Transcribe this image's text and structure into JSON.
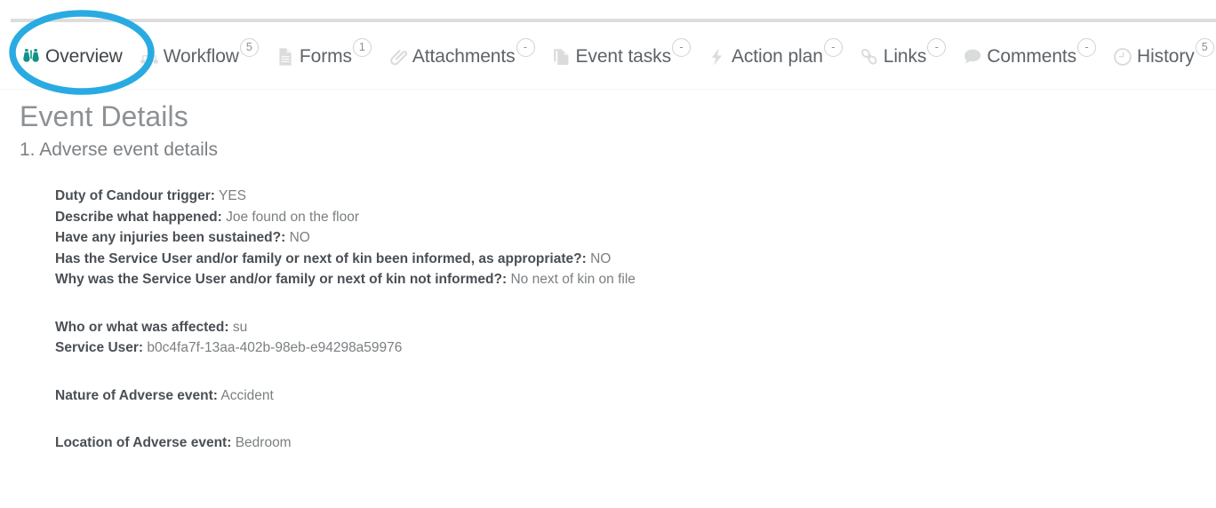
{
  "tabs": [
    {
      "label": "Overview",
      "icon": "binoculars-icon",
      "badge": "",
      "active": true
    },
    {
      "label": "Workflow",
      "icon": "sitemap-icon",
      "badge": "5",
      "active": false
    },
    {
      "label": "Forms",
      "icon": "document-icon",
      "badge": "1",
      "active": false
    },
    {
      "label": "Attachments",
      "icon": "paperclip-icon",
      "badge": "-",
      "active": false
    },
    {
      "label": "Event tasks",
      "icon": "copy-pages-icon",
      "badge": "-",
      "active": false
    },
    {
      "label": "Action plan",
      "icon": "lightning-icon",
      "badge": "-",
      "active": false
    },
    {
      "label": "Links",
      "icon": "chain-link-icon",
      "badge": "-",
      "active": false
    },
    {
      "label": "Comments",
      "icon": "speech-bubble-icon",
      "badge": "-",
      "active": false
    },
    {
      "label": "History",
      "icon": "clock-icon",
      "badge": "5",
      "active": false
    }
  ],
  "content": {
    "page_title": "Event Details",
    "section_title": "1. Adverse event details",
    "groups": [
      {
        "rows": [
          {
            "label": "Duty of Candour trigger:",
            "value": "YES"
          },
          {
            "label": "Describe what happened:",
            "value": "Joe found on the floor"
          },
          {
            "label": "Have any injuries been sustained?:",
            "value": "NO"
          },
          {
            "label": "Has the Service User and/or family or next of kin been informed, as appropriate?:",
            "value": "NO"
          },
          {
            "label": "Why was the Service User and/or family or next of kin not informed?:",
            "value": "No next of kin on file"
          }
        ]
      },
      {
        "rows": [
          {
            "label": "Who or what was affected:",
            "value": "su"
          },
          {
            "label": "Service User:",
            "value": "b0c4fa7f-13aa-402b-98eb-e94298a59976"
          }
        ]
      },
      {
        "rows": [
          {
            "label": "Nature of Adverse event:",
            "value": "Accident"
          }
        ]
      },
      {
        "rows": [
          {
            "label": "Location of Adverse event:",
            "value": "Bedroom"
          }
        ]
      }
    ]
  },
  "annotation": {
    "shape": "ellipse-highlight",
    "color": "#29ABE2"
  },
  "colors": {
    "active_tab_icon": "#0f9185",
    "inactive_icon": "#dadbdc",
    "label_text": "#4a4f54",
    "value_text": "#7b7f82",
    "title_text": "#8d9094",
    "annotation": "#29ABE2"
  }
}
